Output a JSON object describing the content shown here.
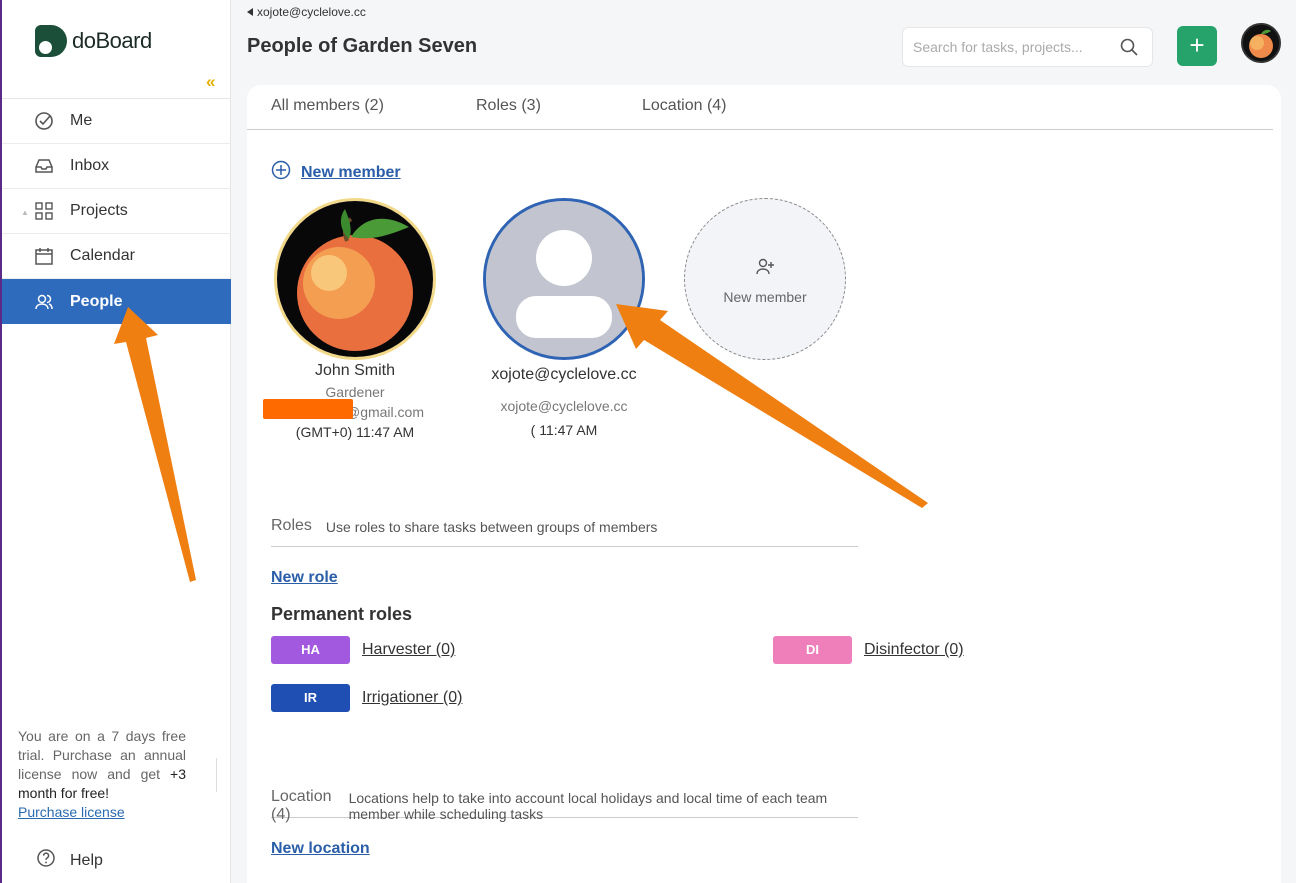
{
  "app": {
    "logo_text": "doBoard",
    "collapse_glyph": "«"
  },
  "sidebar": {
    "items": [
      {
        "label": "Me",
        "icon": "check-circle-icon"
      },
      {
        "label": "Inbox",
        "icon": "inbox-icon"
      },
      {
        "label": "Projects",
        "icon": "grid-icon"
      },
      {
        "label": "Calendar",
        "icon": "calendar-icon"
      },
      {
        "label": "People",
        "icon": "people-icon",
        "active": true
      }
    ],
    "trial": {
      "text": "You are on a 7 days free trial. Purchase an annual license now and get",
      "highlight": "+3 month for free!",
      "link": "Purchase license"
    },
    "help": "Help"
  },
  "header": {
    "breadcrumb": "xojote@cyclelove.cc",
    "title": "People of Garden Seven",
    "search_placeholder": "Search for tasks, projects...",
    "add_label": "+"
  },
  "tabs": [
    {
      "label": "All members (2)"
    },
    {
      "label": "Roles (3)"
    },
    {
      "label": "Location (4)"
    }
  ],
  "members_section": {
    "new_member_link": "New member",
    "members": [
      {
        "name": "John Smith",
        "role": "Gardener",
        "email": "@gmail.com",
        "time": "(GMT+0) 11:47 AM"
      },
      {
        "name": "xojote@cyclelove.cc",
        "role": "",
        "email": "xojote@cyclelove.cc",
        "time": "( 11:47 AM"
      }
    ],
    "new_member_card": "New member"
  },
  "roles_section": {
    "heading": "Roles",
    "description": "Use roles to share tasks between groups of members",
    "new_role": "New role",
    "permanent_title": "Permanent roles",
    "roles": [
      {
        "abbr": "HA",
        "name": "Harvester (0)",
        "color": "#a259e0"
      },
      {
        "abbr": "DI",
        "name": "Disinfector (0)",
        "color": "#ef7fba"
      },
      {
        "abbr": "IR",
        "name": "Irrigationer (0)",
        "color": "#1f4fb2"
      }
    ]
  },
  "location_section": {
    "heading": "Location (4)",
    "description": "Locations help to take into account local holidays and local time of each team member while scheduling tasks",
    "new_location": "New location"
  },
  "colors": {
    "accent": "#2f6bbd",
    "green": "#25a36a",
    "arrow": "#f07f12",
    "logo": "#1b4f3a"
  }
}
